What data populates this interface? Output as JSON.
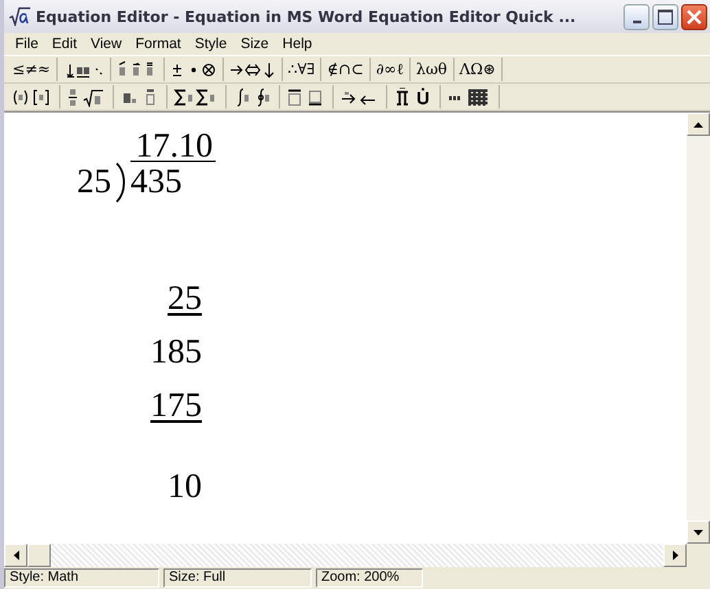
{
  "window": {
    "title": "Equation Editor - Equation in MS Word Equation Editor Quick ..."
  },
  "menu": [
    {
      "label": "File"
    },
    {
      "label": "Edit"
    },
    {
      "label": "View"
    },
    {
      "label": "Format"
    },
    {
      "label": "Style"
    },
    {
      "label": "Size"
    },
    {
      "label": "Help"
    }
  ],
  "symbol_palettes": [
    "≤≠≈",
    "∴∀∃",
    "∉∩⊂",
    "∂∞ℓ",
    "λωθ",
    "ΛΩ⊛"
  ],
  "division": {
    "quotient": "17.10",
    "divisor": "25",
    "dividend": "435",
    "steps": [
      {
        "text": "25",
        "underlined": true
      },
      {
        "text": "185",
        "underlined": false
      },
      {
        "text": "175",
        "underlined": true
      },
      {
        "text": "10",
        "underlined": false
      }
    ]
  },
  "status_bar": [
    "Style: Math",
    "Size: Full",
    "Zoom: 200%"
  ]
}
